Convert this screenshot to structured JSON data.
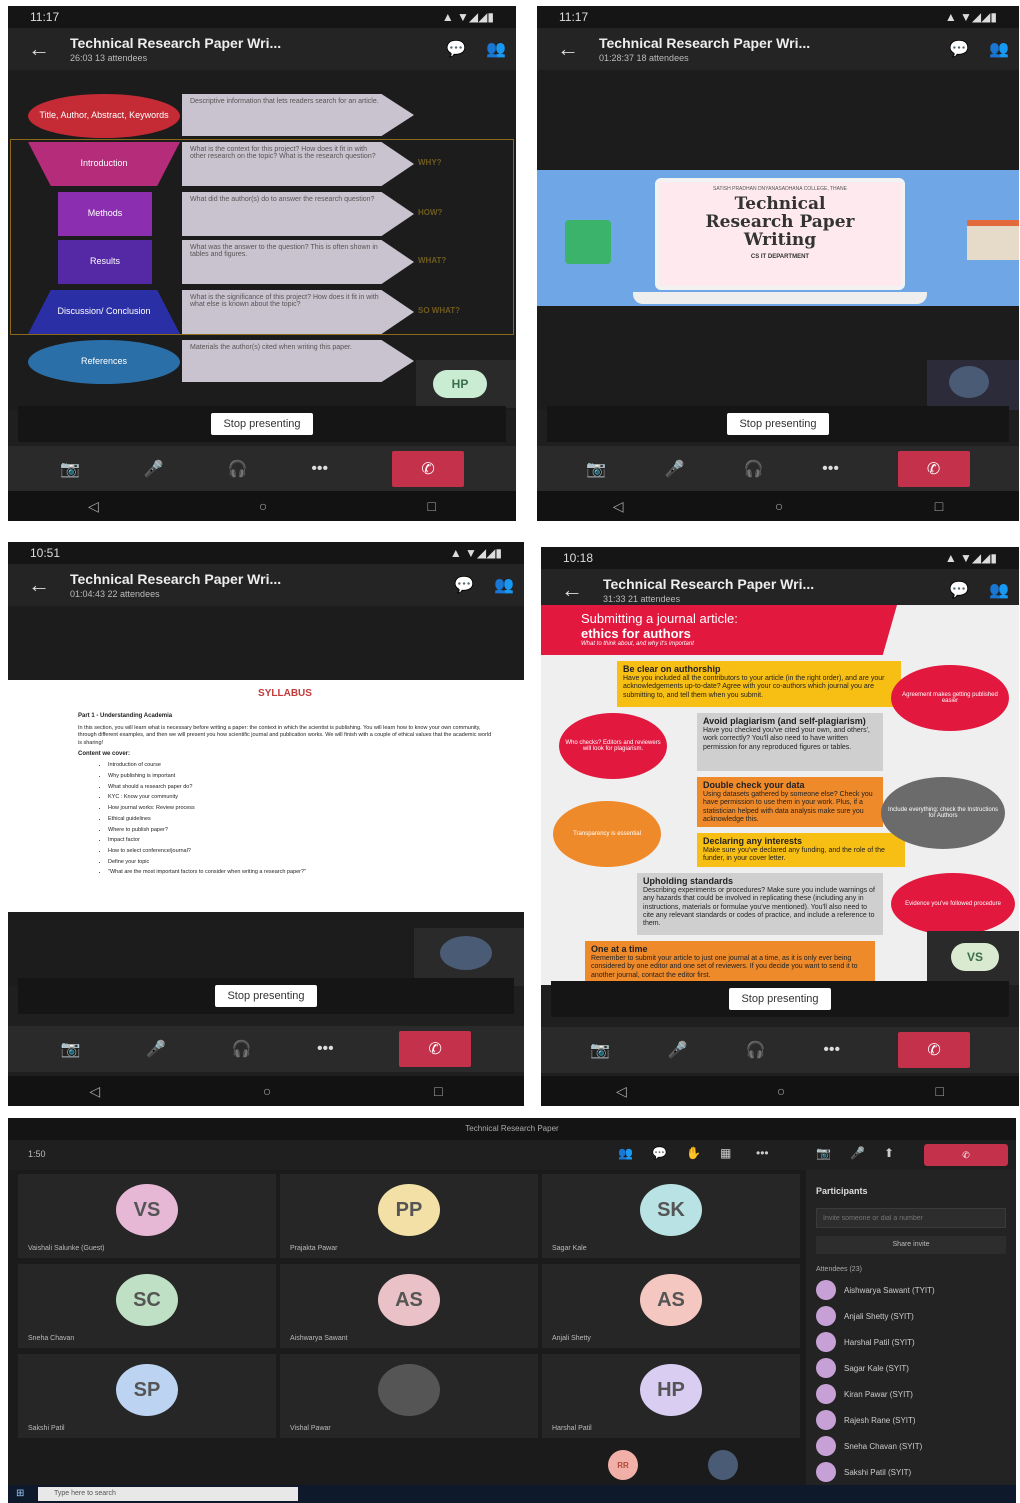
{
  "screen1": {
    "time": "11:17",
    "title": "Technical Research Paper Wri...",
    "subtitle": "26:03  13 attendees",
    "shapes": [
      {
        "label": "Title, Author, Abstract, Keywords",
        "desc": "Descriptive information that lets readers search for an article."
      },
      {
        "label": "Introduction",
        "desc": "What is the context for this project? How does it fit in with other research on the topic? What is the research question?"
      },
      {
        "label": "Methods",
        "desc": "What did the author(s) do to answer the research question?"
      },
      {
        "label": "Results",
        "desc": "What was the answer to the question? This is often shown in tables and figures."
      },
      {
        "label": "Discussion/ Conclusion",
        "desc": "What is the significance of this project? How does it fit in with what else is known about the topic?"
      },
      {
        "label": "References",
        "desc": "Materials the author(s) cited when writing this paper."
      }
    ],
    "questions": [
      "WHY?",
      "HOW?",
      "WHAT?",
      "SO WHAT?"
    ],
    "avatar": "HP",
    "stop_label": "Stop presenting"
  },
  "screen2": {
    "time": "11:17",
    "title": "Technical Research Paper Wri...",
    "subtitle": "01:28:37  18 attendees",
    "college": "SATISH PRADHAN DNYANASADHANA COLLEGE, THANE",
    "slide_title": "Technical Research Paper Writing",
    "dept": "CS IT DEPARTMENT",
    "stop_label": "Stop presenting"
  },
  "screen3": {
    "time": "10:51",
    "title": "Technical Research Paper Wri...",
    "subtitle": "01:04:43  22 attendees",
    "doc_title": "SYLLABUS",
    "part": "Part 1 - Understanding Academia",
    "intro": "In this section, you will learn what is necessary before writing a paper: the context in which the scientist is publishing. You will learn how to know your own community, through different examples, and then we will present you how scientific journal and publication works. We will finish with a couple of ethical values that the academic world is sharing!",
    "content_heading": "Content we cover:",
    "items": [
      "Introduction of course",
      "Why publishing is important",
      "What should a research paper do?",
      "KYC : Know your community",
      "How journal works: Review process",
      "Ethical guidelines",
      "Where to publish paper?",
      "Impact factor",
      "How to select conference/journal?",
      "Define your topic",
      "\"What are the most important factors to consider when writing a research paper?\""
    ],
    "stop_label": "Stop presenting"
  },
  "screen4": {
    "time": "10:18",
    "title": "Technical Research Paper Wri...",
    "subtitle": "31:33  21 attendees",
    "banner_line1": "Submitting a journal article:",
    "banner_line2": "ethics for authors",
    "banner_sub": "What to think about, and why it's important",
    "cards": [
      {
        "head": "Be clear on authorship",
        "body": "Have you included all the contributors to your article (in the right order), and are your acknowledgements up-to-date? Agree with your co-authors which journal you are submitting to, and tell them when you submit."
      },
      {
        "head": "Avoid plagiarism (and self-plagiarism)",
        "body": "Have you checked you've cited your own, and others', work correctly? You'll also need to have written permission for any reproduced figures or tables."
      },
      {
        "head": "Double check your data",
        "body": "Using datasets gathered by someone else? Check you have permission to use them in your work. Plus, if a statistician helped with data analysis make sure you acknowledge this."
      },
      {
        "head": "Declaring any interests",
        "body": "Make sure you've declared any funding, and the role of the funder, in your cover letter."
      },
      {
        "head": "Upholding standards",
        "body": "Describing experiments or procedures? Make sure you include warnings of any hazards that could be involved in replicating these (including any in instructions, materials or formulae you've mentioned). You'll also need to cite any relevant standards or codes of practice, and include a reference to them."
      },
      {
        "head": "One at a time",
        "body": "Remember to submit your article to just one journal at a time, as it is only ever being considered by one editor and one set of reviewers. If you decide you want to send it to another journal, contact the editor first."
      }
    ],
    "bubbles": [
      "Who checks? Editors and reviewers will look for plagiarism.",
      "Transparency is essential",
      "Agreement makes getting published easier",
      "Include everything: check the Instructions for Authors",
      "Evidence you've followed procedure"
    ],
    "avatar": "VS",
    "stop_label": "Stop presenting"
  },
  "desktop": {
    "window_title": "Technical Research Paper",
    "clock": "1:50",
    "tiles": [
      {
        "initials": "VS",
        "name": "Vaishali Salunke (Guest)",
        "color": "#e7b7d6"
      },
      {
        "initials": "PP",
        "name": "Prajakta Pawar",
        "color": "#f3e0a6"
      },
      {
        "initials": "SK",
        "name": "Sagar Kale",
        "color": "#b9e2e4"
      },
      {
        "initials": "SC",
        "name": "Sneha Chavan",
        "color": "#bfe0c4"
      },
      {
        "initials": "AS",
        "name": "Aishwarya Sawant",
        "color": "#e9c1c6"
      },
      {
        "initials": "AS",
        "name": "Anjali Shetty",
        "color": "#f4c8c0"
      },
      {
        "initials": "SP",
        "name": "Sakshi Patil",
        "color": "#bcd4f1"
      },
      {
        "initials": "",
        "name": "Vishal Pawar",
        "color": "#555555"
      },
      {
        "initials": "HP",
        "name": "Harshal Patil",
        "color": "#d9cdf2"
      }
    ],
    "participants_title": "Participants",
    "search_placeholder": "Invite someone or dial a number",
    "share_label": "Share invite",
    "attendees_label": "Attendees (23)",
    "participants": [
      "Aishwarya Sawant (TYIT)",
      "Anjali Shetty (SYIT)",
      "Harshal Patil (SYIT)",
      "Sagar Kale (SYIT)",
      "Kiran Pawar (SYIT)",
      "Rajesh Rane (SYIT)",
      "Sneha Chavan (SYIT)",
      "Sakshi Patil (SYIT)"
    ],
    "taskbar_search": "Type here to search",
    "bottom_avatar": "RR"
  }
}
